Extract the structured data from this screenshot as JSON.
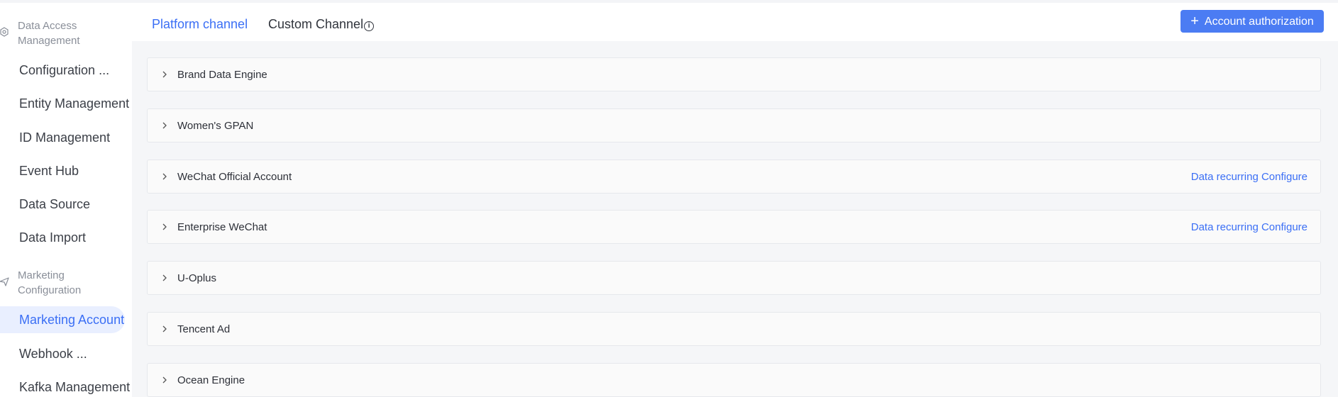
{
  "sidebar": {
    "groups": [
      {
        "label_line1": "Data Access",
        "label_line2": "Management",
        "icon": "data-access-icon"
      },
      {
        "label_line1": "Marketing",
        "label_line2": "Configuration",
        "icon": "send-icon"
      }
    ],
    "items": [
      {
        "label": "Configuration ..."
      },
      {
        "label": "Entity Management"
      },
      {
        "label": "ID Management"
      },
      {
        "label": "Event Hub"
      },
      {
        "label": "Data Source"
      },
      {
        "label": "Data Import"
      },
      {
        "label": "Marketing Account",
        "active": true
      },
      {
        "label": "Webhook ..."
      },
      {
        "label": "Kafka Management"
      }
    ]
  },
  "tabs": [
    {
      "label": "Platform channel",
      "active": true
    },
    {
      "label": "Custom Channel",
      "icon": "info-icon"
    }
  ],
  "toolbar": {
    "authorize_label": "Account authorization",
    "authorize_icon": "plus-icon"
  },
  "panels": [
    {
      "title": "Brand Data Engine",
      "link": ""
    },
    {
      "title": "Women's GPAN",
      "link": ""
    },
    {
      "title": "WeChat Official Account",
      "link": "Data recurring Configure"
    },
    {
      "title": "Enterprise WeChat",
      "link": "Data recurring Configure"
    },
    {
      "title": "U-Oplus",
      "link": ""
    },
    {
      "title": "Tencent Ad",
      "link": ""
    },
    {
      "title": "Ocean Engine",
      "link": ""
    }
  ],
  "colors": {
    "accent": "#3b6ff5",
    "button": "#4b7cf3",
    "active_bg": "#e9efff"
  }
}
